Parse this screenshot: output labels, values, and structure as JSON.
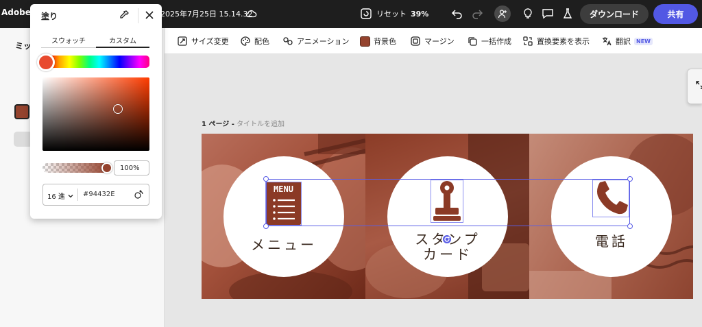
{
  "app": {
    "title": "Adobe E",
    "document_title": "2025年7月25日 15.14.32"
  },
  "topbar": {
    "reset_label": "リセット",
    "zoom": "39%",
    "download_label": "ダウンロード",
    "share_label": "共有"
  },
  "toolbar": {
    "items": [
      {
        "label": "サイズ変更"
      },
      {
        "label": "配色"
      },
      {
        "label": "アニメーション"
      },
      {
        "label": "背景色"
      },
      {
        "label": "マージン"
      },
      {
        "label": "一括作成"
      },
      {
        "label": "置換要素を表示"
      },
      {
        "label": "翻訳"
      }
    ],
    "new_badge": "NEW",
    "background_swatch_color": "#94432e"
  },
  "left_panel": {
    "title": "ミッ"
  },
  "fill_popover": {
    "title": "塗り",
    "tabs": [
      "スウォッチ",
      "カスタム"
    ],
    "active_tab": "カスタム",
    "opacity": "100%",
    "format": "16 進",
    "hex_value": "#94432E",
    "current_color": "#94432e"
  },
  "page": {
    "number_label": "1 ページ -",
    "title_placeholder": "タイトルを追加"
  },
  "canvas": {
    "menu_icon_text": "MENU",
    "labels": {
      "menu": "メニュー",
      "stamp_line1": "スタンプ",
      "stamp_line2": "カード",
      "phone": "電話"
    },
    "icon_color": "#8b3a26"
  }
}
